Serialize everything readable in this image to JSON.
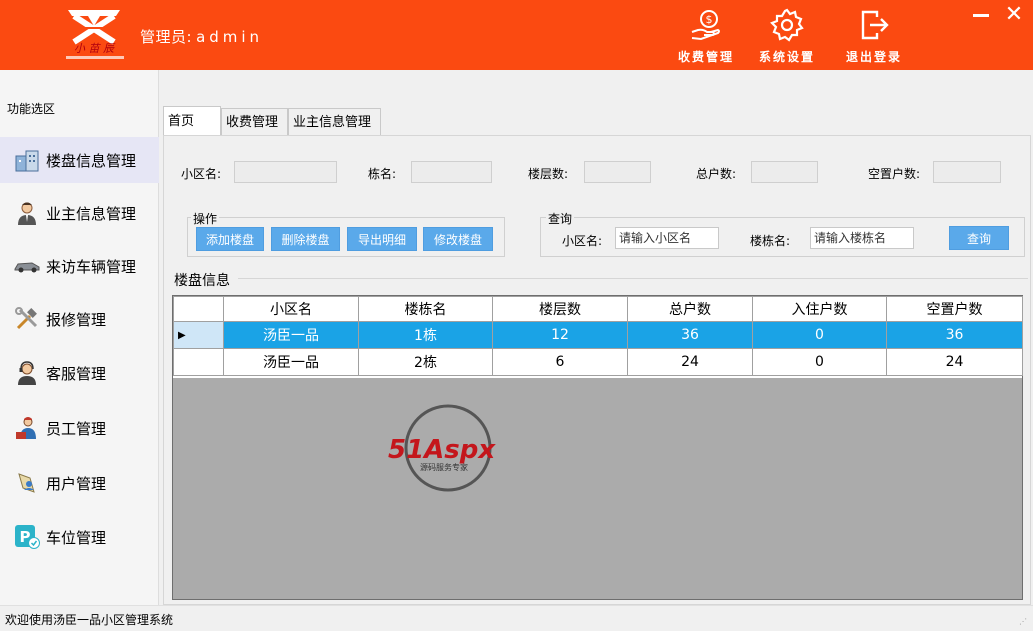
{
  "header": {
    "admin_label": "管理员:",
    "admin_value": "admin",
    "buttons": [
      {
        "label": "收费管理",
        "icon": "money-hand-icon"
      },
      {
        "label": "系统设置",
        "icon": "gear-icon"
      },
      {
        "label": "退出登录",
        "icon": "logout-icon"
      }
    ],
    "close_glyph": "✕"
  },
  "sidebar": {
    "title": "功能选区",
    "items": [
      {
        "label": "楼盘信息管理",
        "icon": "buildings-icon"
      },
      {
        "label": "业主信息管理",
        "icon": "person-icon"
      },
      {
        "label": "来访车辆管理",
        "icon": "car-icon"
      },
      {
        "label": "报修管理",
        "icon": "tools-icon"
      },
      {
        "label": "客服管理",
        "icon": "headset-icon"
      },
      {
        "label": "员工管理",
        "icon": "worker-icon"
      },
      {
        "label": "用户管理",
        "icon": "user-icon"
      },
      {
        "label": "车位管理",
        "icon": "parking-icon"
      }
    ]
  },
  "tabs": [
    {
      "label": "首页"
    },
    {
      "label": "收费管理"
    },
    {
      "label": "业主信息管理"
    }
  ],
  "fields": {
    "community": "小区名:",
    "building": "栋名:",
    "floors": "楼层数:",
    "households": "总户数:",
    "vacant": "空置户数:"
  },
  "ops": {
    "title": "操作",
    "add": "添加楼盘",
    "delete": "删除楼盘",
    "export": "导出明细",
    "edit": "修改楼盘"
  },
  "query": {
    "title": "查询",
    "community_label": "小区名:",
    "community_placeholder": "请输入小区名",
    "building_label": "楼栋名:",
    "building_placeholder": "请输入楼栋名",
    "button": "查询"
  },
  "table": {
    "section_title": "楼盘信息",
    "columns": [
      "小区名",
      "楼栋名",
      "楼层数",
      "总户数",
      "入住户数",
      "空置户数"
    ],
    "rows": [
      [
        "汤臣一品",
        "1栋",
        "12",
        "36",
        "0",
        "36"
      ],
      [
        "汤臣一品",
        "2栋",
        "6",
        "24",
        "0",
        "24"
      ]
    ],
    "row_indicator": "▶"
  },
  "watermark": {
    "brand": "51Aspx",
    "tagline": "源码服务专家"
  },
  "status": "欢迎使用汤臣一品小区管理系统"
}
